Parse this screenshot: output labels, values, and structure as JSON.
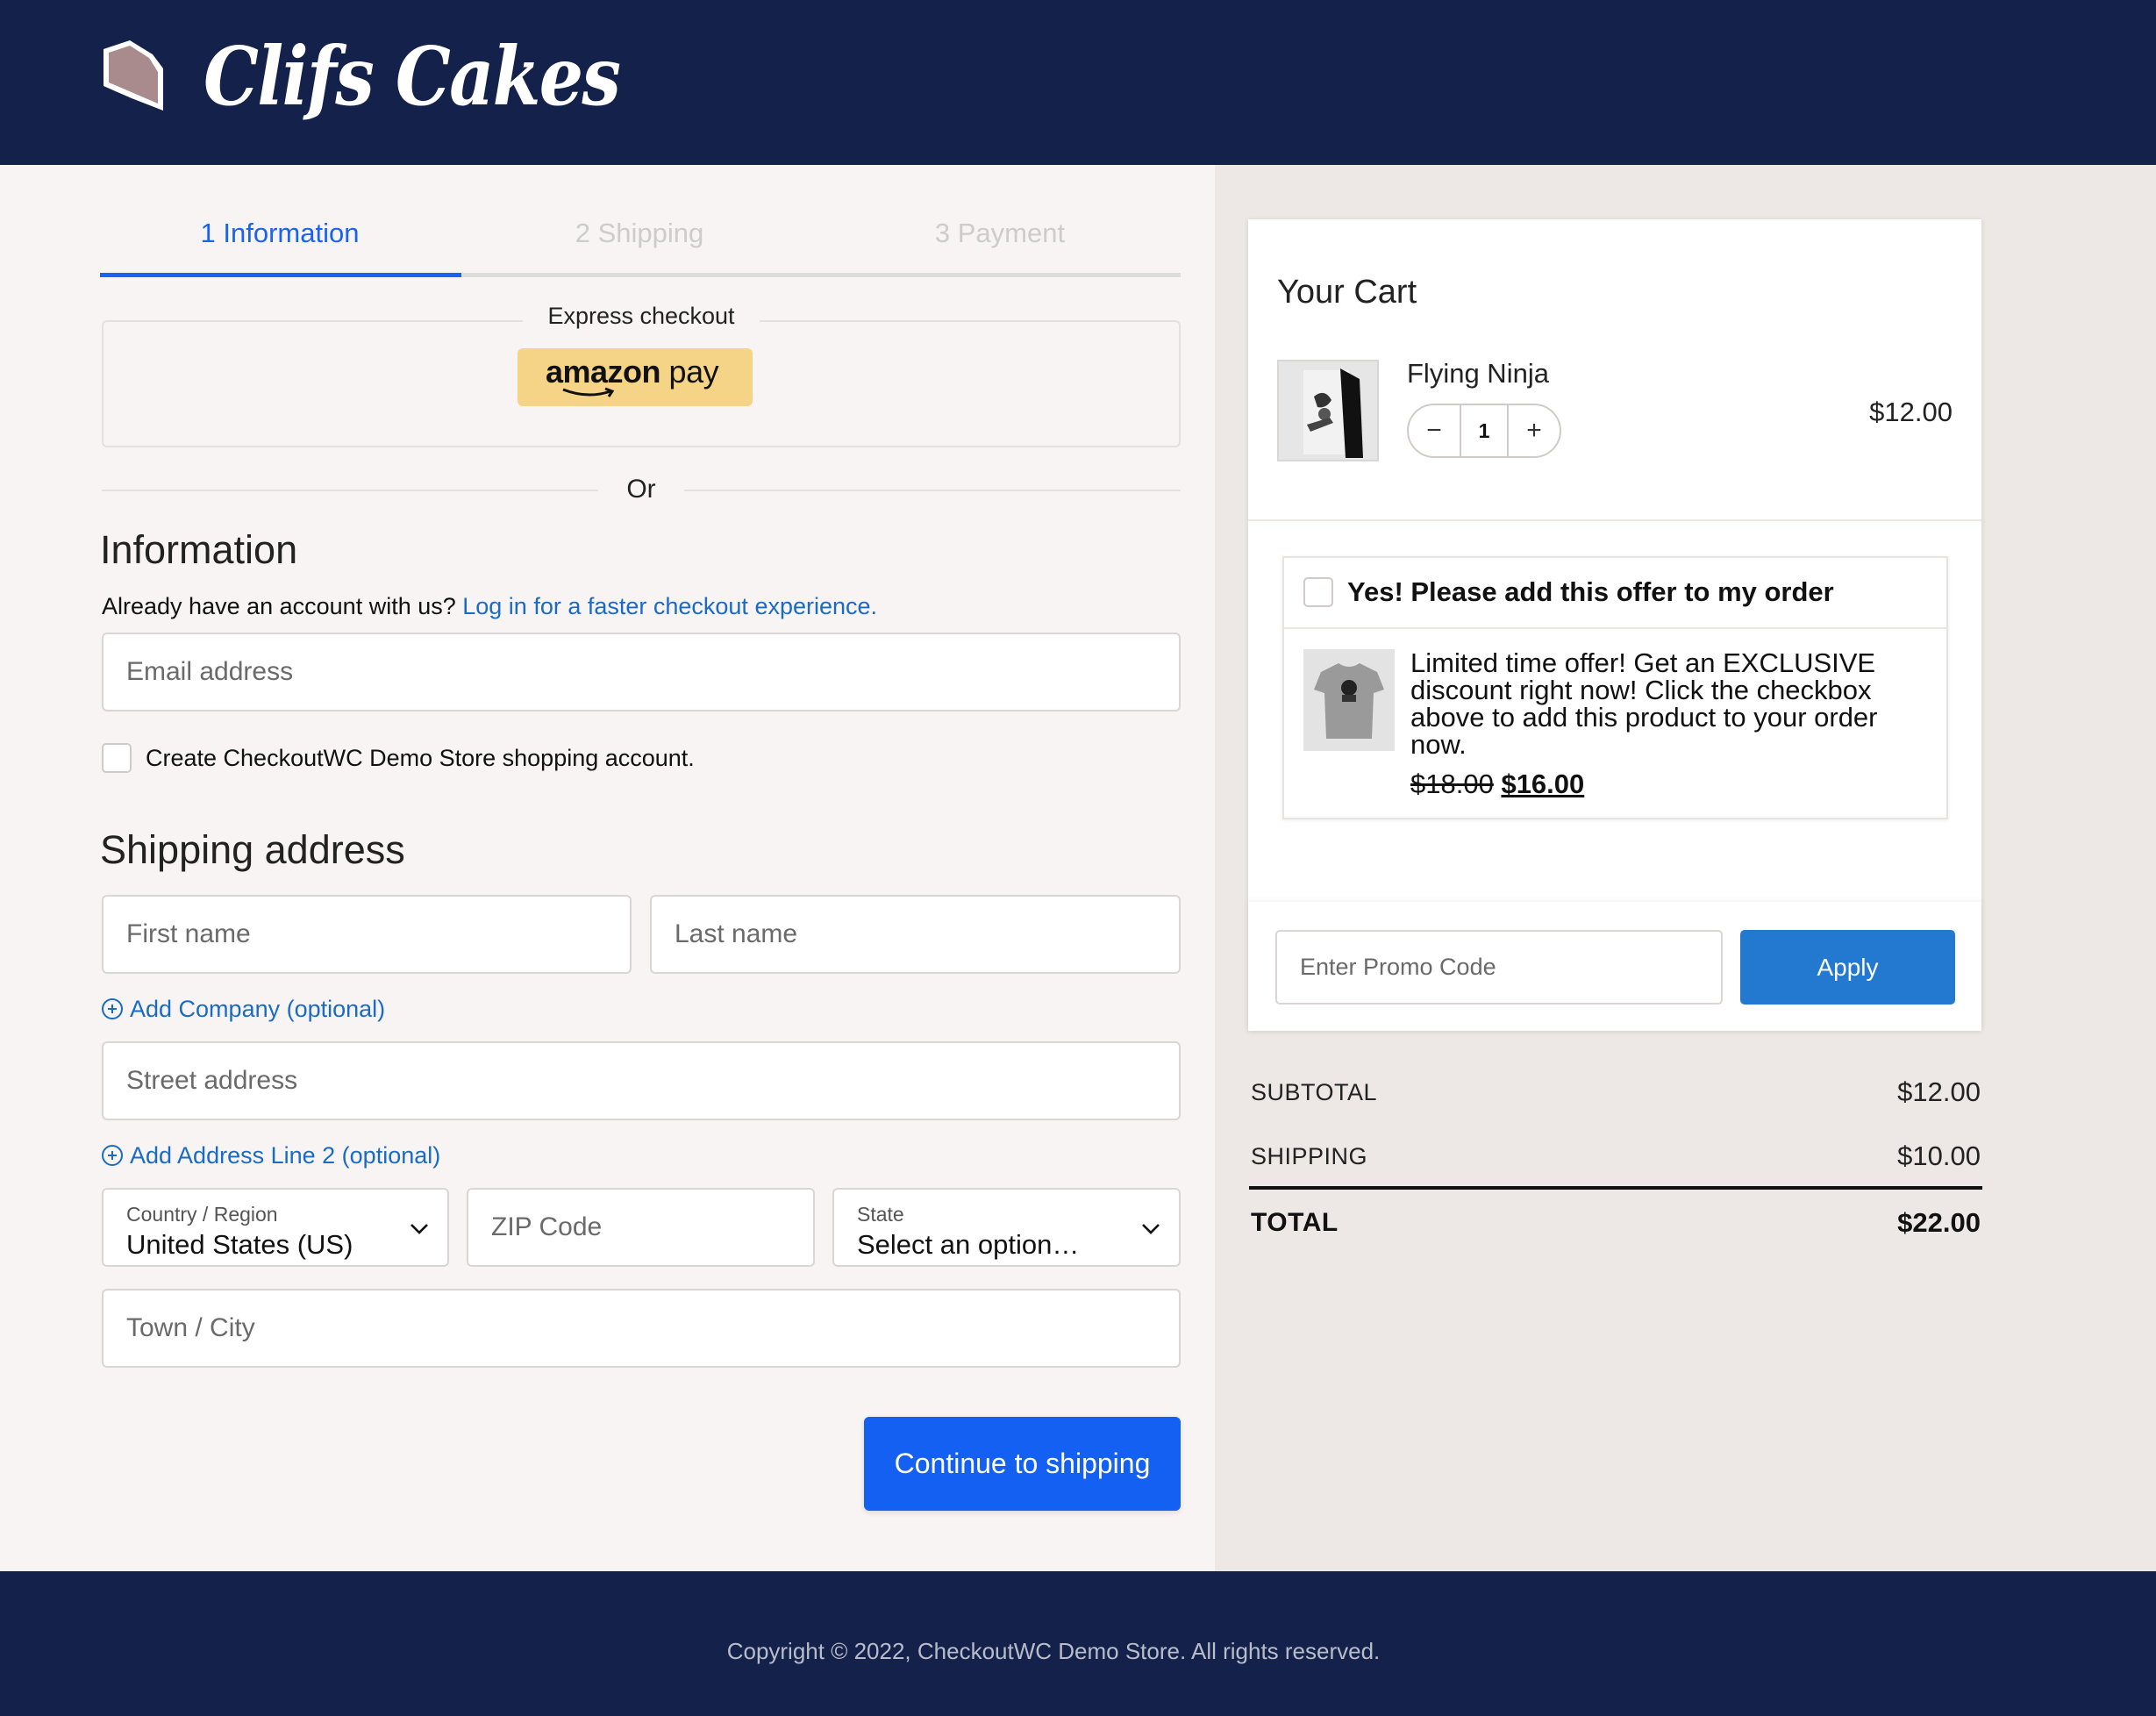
{
  "header": {
    "brand": "Clifs Cakes",
    "logo_icon": "cake-slice-icon",
    "background": "#14214b"
  },
  "steps": [
    {
      "label": "1 Information",
      "active": true
    },
    {
      "label": "2 Shipping",
      "active": false
    },
    {
      "label": "3 Payment",
      "active": false
    }
  ],
  "express": {
    "label": "Express checkout",
    "amazon_word": "amazon",
    "amazon_pay": " pay",
    "or": "Or"
  },
  "information": {
    "title": "Information",
    "account_prompt": "Already have an account with us? ",
    "login_link": "Log in for a faster checkout experience.",
    "email_placeholder": "Email address",
    "create_account_label": "Create CheckoutWC Demo Store shopping account."
  },
  "shipping": {
    "title": "Shipping address",
    "first_name_placeholder": "First name",
    "last_name_placeholder": "Last name",
    "add_company": "Add Company (optional)",
    "street_placeholder": "Street address",
    "add_line2": "Add Address Line 2 (optional)",
    "country_label": "Country / Region",
    "country_value": "United States (US)",
    "zip_placeholder": "ZIP Code",
    "state_label": "State",
    "state_value": "Select an option…",
    "city_placeholder": "Town / City",
    "continue_label": "Continue to shipping"
  },
  "cart": {
    "title": "Your Cart",
    "item": {
      "name": "Flying Ninja",
      "quantity": "1",
      "price": "$12.00",
      "minus": "−",
      "plus": "+"
    },
    "offer": {
      "heading": "Yes! Please add this offer to my order",
      "text": "Limited time offer! Get an EXCLUSIVE discount right now! Click the checkbox above to add this product to your order now.",
      "old_price": "$18.00",
      "new_price": "$16.00"
    },
    "promo_placeholder": "Enter Promo Code",
    "apply_label": "Apply"
  },
  "summary": {
    "subtotal_label": "SUBTOTAL",
    "subtotal_value": "$12.00",
    "shipping_label": "SHIPPING",
    "shipping_value": "$10.00",
    "total_label": "TOTAL",
    "total_value": "$22.00"
  },
  "footer": {
    "copyright": "Copyright © 2022, CheckoutWC Demo Store. All rights reserved."
  },
  "colors": {
    "primary": "#1460f2",
    "link": "#1a6bc4",
    "apply": "#2379d0",
    "amazon": "#f5d487"
  }
}
